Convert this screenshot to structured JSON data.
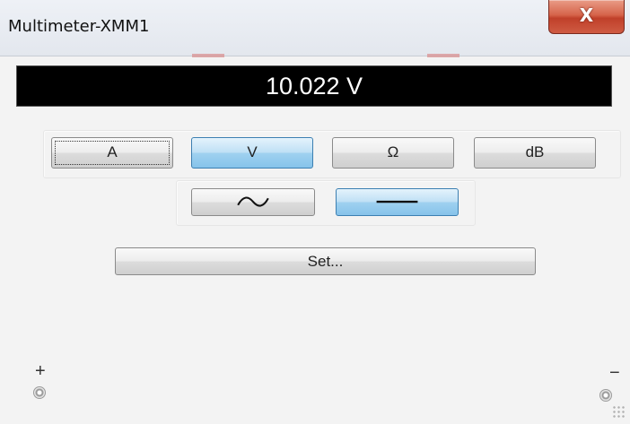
{
  "window": {
    "title": "Multimeter-XMM1",
    "close_label": "X"
  },
  "display": {
    "reading": "10.022 V"
  },
  "mode_buttons": [
    {
      "label": "A",
      "state": "focused"
    },
    {
      "label": "V",
      "state": "selected"
    },
    {
      "label": "Ω",
      "state": "normal"
    },
    {
      "label": "dB",
      "state": "normal"
    }
  ],
  "signal_buttons": [
    {
      "icon": "ac-sine-icon",
      "state": "normal"
    },
    {
      "icon": "dc-line-icon",
      "state": "selected"
    }
  ],
  "set_button": {
    "label": "Set..."
  },
  "terminals": {
    "positive_label": "+",
    "negative_label": "−"
  },
  "colors": {
    "display_bg": "#000000",
    "display_text": "#ffffff",
    "selected_button": "#9fd1f0",
    "close_button": "#c8503a"
  }
}
